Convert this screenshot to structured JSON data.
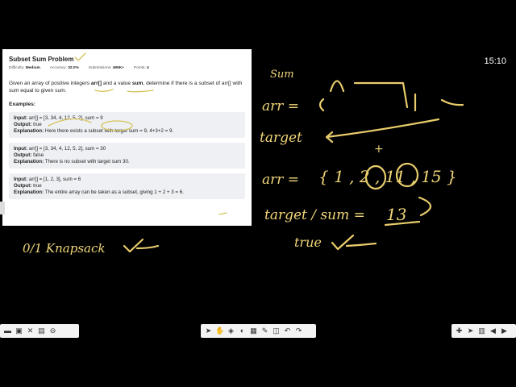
{
  "clock": "15:10",
  "problem": {
    "title": "Subset Sum Problem",
    "difficulty_label": "Difficulty:",
    "difficulty": "Medium",
    "accuracy_label": "Accuracy:",
    "accuracy": "32.0%",
    "submissions_label": "Submissions:",
    "submissions": "495K+",
    "points_label": "Points:",
    "points": "4",
    "desc_1": "Given an array of positive integers ",
    "desc_arr": "arr[]",
    "desc_2": " and a value ",
    "desc_sum": "sum",
    "desc_3": ", determine if there is a subset of arr[] with sum equal to given sum.",
    "examples_heading": "Examples:",
    "examples": [
      {
        "input": "arr[] = [3, 34, 4, 12, 5, 2], sum = 9",
        "output": "true",
        "explanation": "Here there exists a subset with target sum = 9, 4+3+2 = 9."
      },
      {
        "input": "arr[] = [3, 34, 4, 12, 5, 2], sum = 30",
        "output": "false",
        "explanation": "There is no subset with target sum 30."
      },
      {
        "input": "arr[] = [1, 2, 3], sum = 6",
        "output": "true",
        "explanation": "The entire array can be taken as a subset, giving 1 + 2 + 3 = 6."
      }
    ],
    "input_label": "Input:",
    "output_label": "Output:",
    "explanation_label": "Explanation:"
  },
  "handwriting": {
    "knapsack": "0/1 Knapsack",
    "sum_word": "Sum",
    "arr_eq": "arr =",
    "target": "target",
    "plus": "+",
    "arr2": "arr =",
    "set": "{ 1 , 2 , 11 , 15 }",
    "target_sum": "target / sum =",
    "thirteen": "13",
    "true_word": "true"
  },
  "toolbars": {
    "left": [
      "minimize-icon",
      "monitor-icon",
      "tools-icon",
      "image-icon",
      "zoom-out-icon"
    ],
    "middle": [
      "cursor-icon",
      "hand-icon",
      "bucket-icon",
      "shapes-icon",
      "gallery-icon",
      "pen-icon",
      "eraser-icon",
      "undo-icon",
      "redo-icon"
    ],
    "right": [
      "add-icon",
      "select-icon",
      "page-icon",
      "prev-icon",
      "next-icon"
    ]
  }
}
